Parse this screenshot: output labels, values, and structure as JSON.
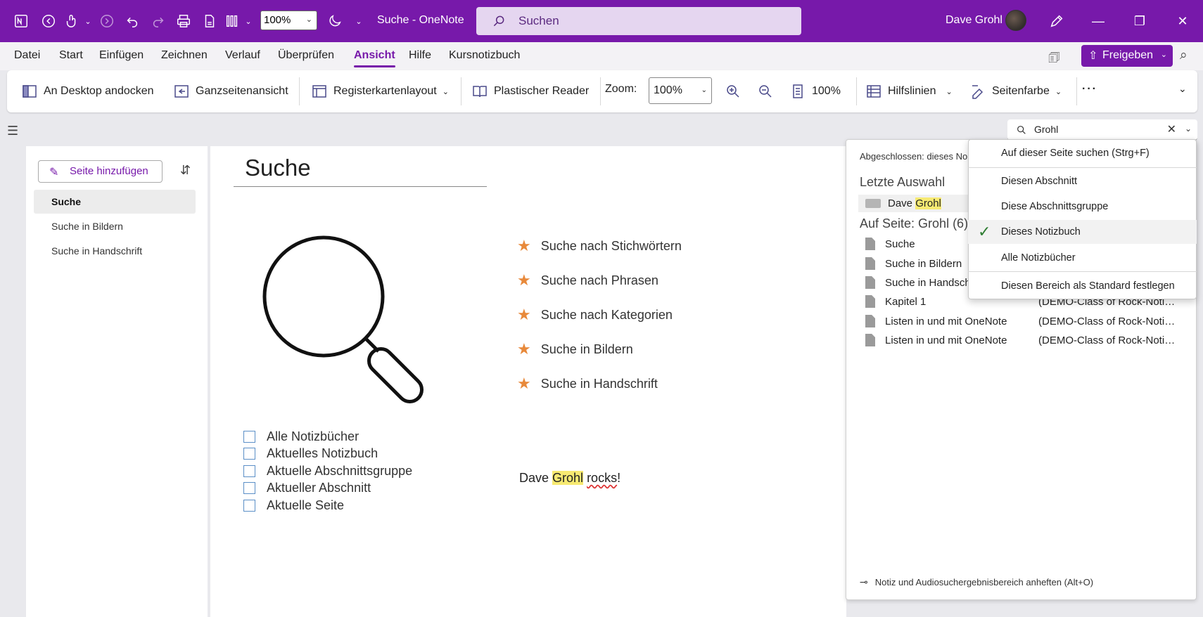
{
  "titlebar": {
    "zoom": "100%",
    "title": "Suche  -  OneNote",
    "search_placeholder": "Suchen",
    "user": "Dave Grohl"
  },
  "menu": {
    "items": [
      "Datei",
      "Start",
      "Einfügen",
      "Zeichnen",
      "Verlauf",
      "Überprüfen",
      "Ansicht",
      "Hilfe",
      "Kursnotizbuch"
    ],
    "active": "Ansicht",
    "share": "Freigeben"
  },
  "ribbon": {
    "dock": "An Desktop andocken",
    "fullpage": "Ganzseitenansicht",
    "tablayout": "Registerkartenlayout",
    "reader": "Plastischer Reader",
    "zoom_label": "Zoom:",
    "zoom_value": "100%",
    "zoom_pct": "100%",
    "rulelines": "Hilfslinien",
    "pagecolor": "Seitenfarbe",
    "more": "···"
  },
  "find": {
    "query": "Grohl"
  },
  "pages": {
    "add_label": "Seite hinzufügen",
    "items": [
      "Suche",
      "Suche in Bildern",
      "Suche in Handschrift"
    ],
    "selected": "Suche"
  },
  "canvas": {
    "title": "Suche",
    "features": [
      "Suche nach Stichwörtern",
      "Suche nach Phrasen",
      "Suche nach Kategorien",
      "Suche in Bildern",
      "Suche in Handschrift"
    ],
    "scopes": [
      "Alle Notizbücher",
      "Aktuelles Notizbuch",
      "Aktuelle Abschnittsgruppe",
      "Aktueller Abschnitt",
      "Aktuelle Seite"
    ],
    "rock_pre": "Dave ",
    "rock_hl": "Grohl",
    "rock_space": " ",
    "rock_squig": "rocks",
    "rock_end": "!"
  },
  "results": {
    "status": "Abgeschlossen: dieses No",
    "recent_header": "Letzte Auswahl",
    "recent_pre": "Dave ",
    "recent_hl": "Grohl",
    "onpage_header": "Auf Seite: Grohl (6)",
    "rows": [
      {
        "page": "Suche",
        "notebook": ""
      },
      {
        "page": "Suche in Bildern",
        "notebook": ""
      },
      {
        "page": "Suche in Handsch",
        "notebook": ""
      },
      {
        "page": "Kapitel 1",
        "notebook": "(DEMO-Class of Rock-Notizb..."
      },
      {
        "page": "Listen in und mit OneNote",
        "notebook": "(DEMO-Class of Rock-Notizb..."
      },
      {
        "page": "Listen in und mit OneNote",
        "notebook": "(DEMO-Class of Rock-Notizb..."
      }
    ],
    "pin": "Notiz und Audiosuchergebnisbereich anheften (Alt+O)"
  },
  "dropdown": {
    "items": [
      "Auf dieser Seite suchen (Strg+F)",
      "Diesen Abschnitt",
      "Diese Abschnittsgruppe",
      "Dieses Notizbuch",
      "Alle Notizbücher",
      "Diesen Bereich als Standard festlegen"
    ],
    "checked": "Dieses Notizbuch"
  },
  "colors": {
    "accent": "#7719aa",
    "star": "#e8893a",
    "highlight": "#f7ea72"
  }
}
